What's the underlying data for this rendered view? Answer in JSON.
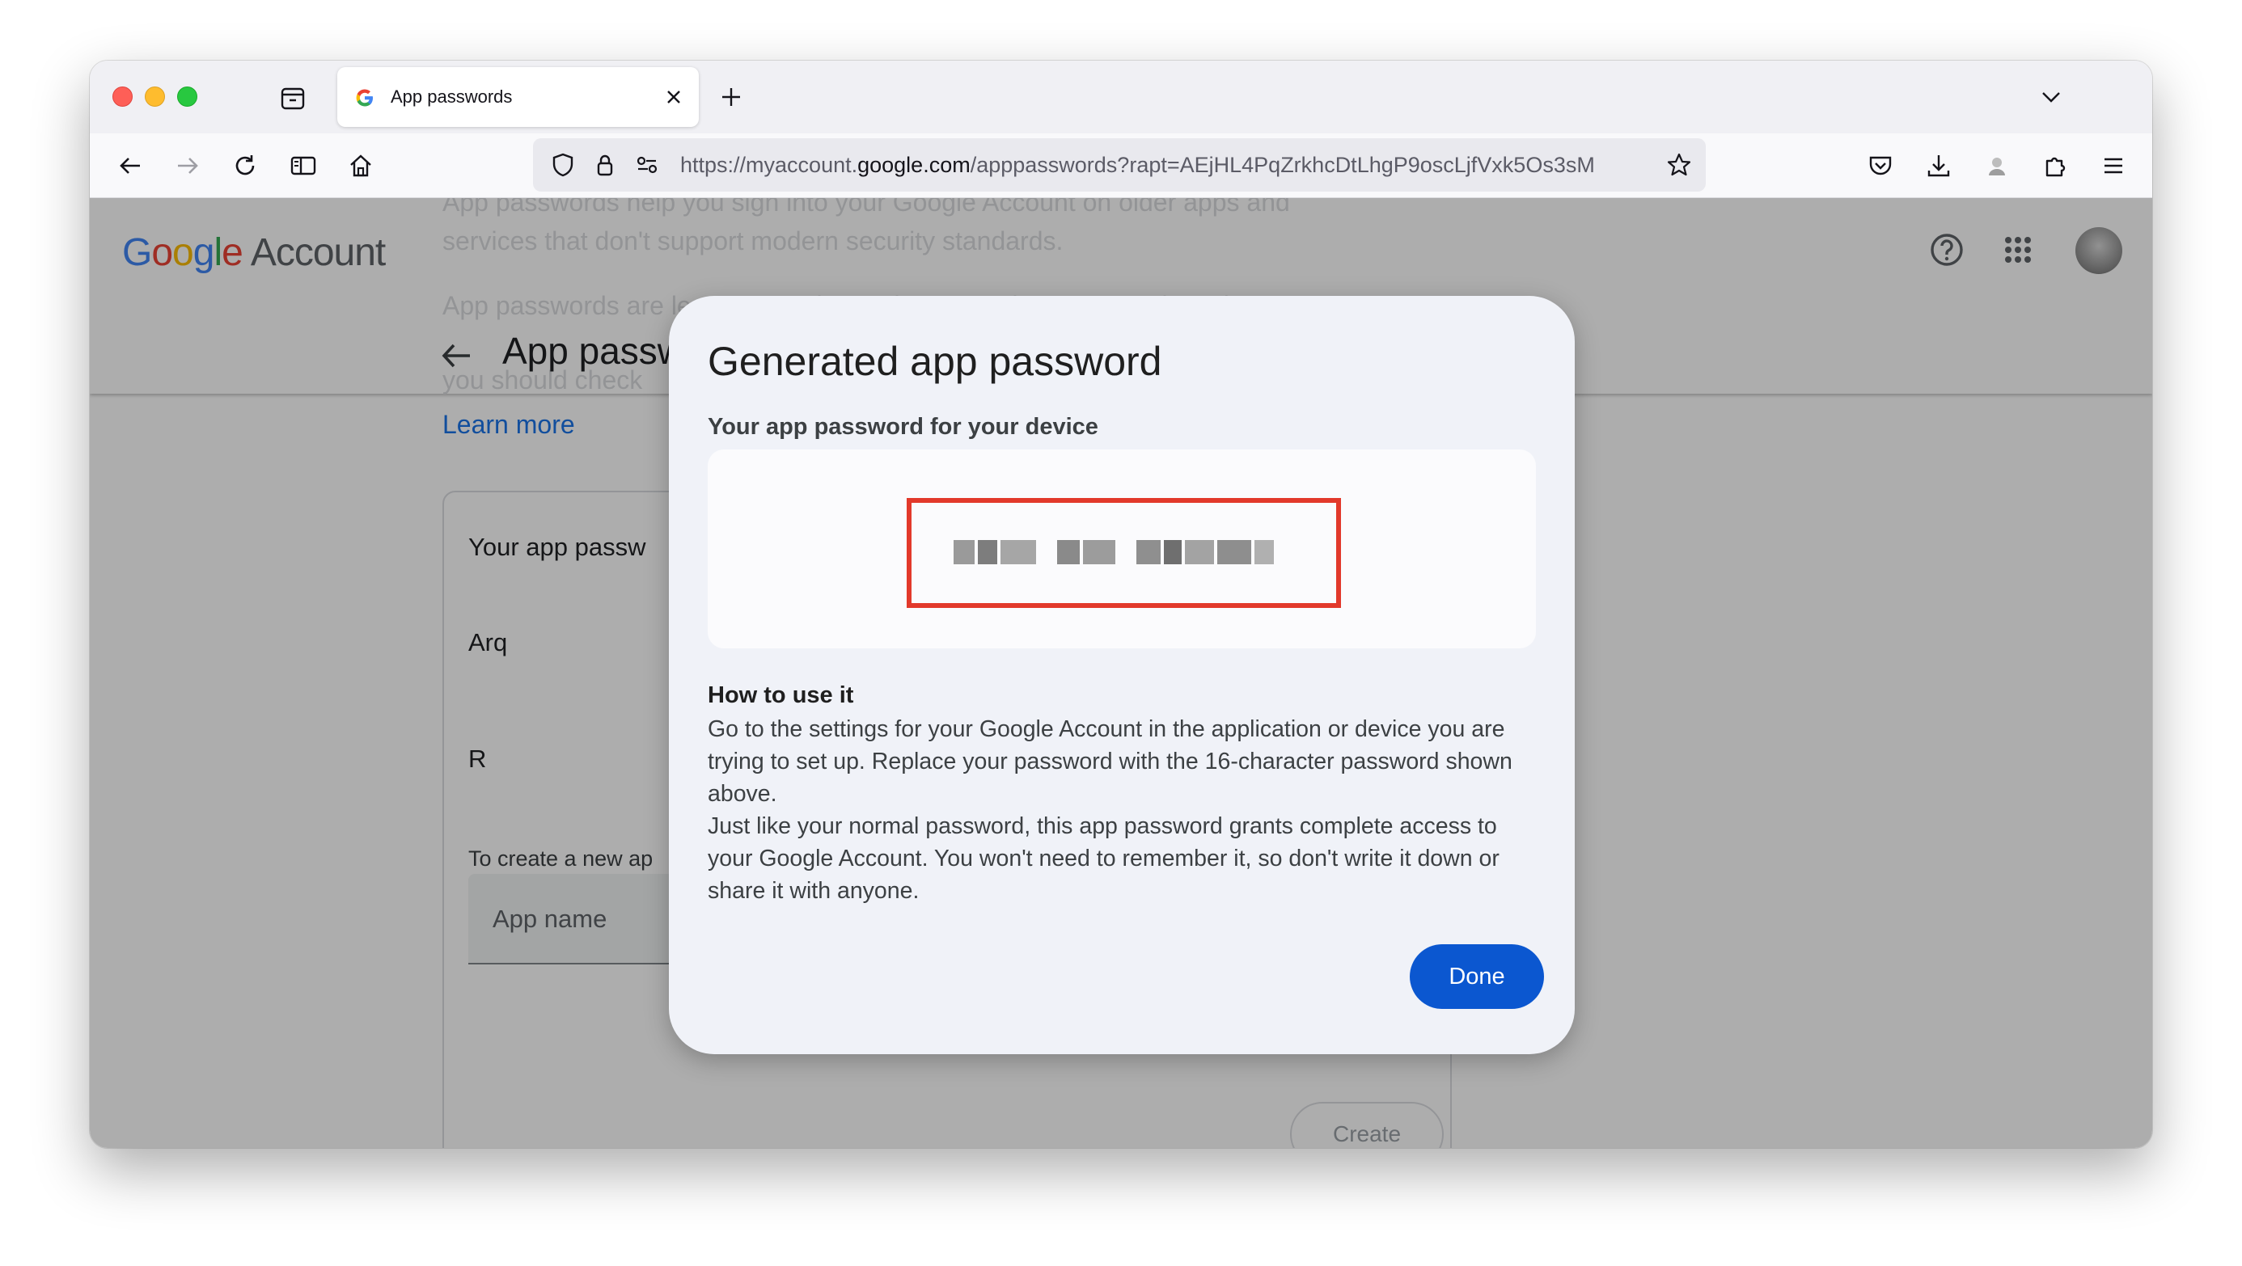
{
  "browser": {
    "tab_title": "App passwords",
    "url_prefix": "https://myaccount.",
    "url_host": "google.com",
    "url_path": "/apppasswords?rapt=AEjHL4PqZrkhcDtLhgP9oscLjfVxk5Os3sM"
  },
  "header": {
    "brand": [
      "G",
      "o",
      "o",
      "g",
      "l",
      "e"
    ],
    "brand_suffix": "Account"
  },
  "page": {
    "title": "App passw",
    "learn_more": "Learn more",
    "faded_line_1": "App passwords help you sign into your Google Account on older apps and",
    "faded_line_2": "services that don't support modern security standards.",
    "faded_line_3": "App passwords are less secure than using up-to-date apps and services",
    "faded_line_4": "you should check",
    "card_title": "Your app passw",
    "app_item_1": "Arq",
    "app_item_2": "R",
    "create_hint": "To create a new ap",
    "app_name_label": "App name",
    "create_button": "Create"
  },
  "dialog": {
    "title": "Generated app password",
    "subtitle": "Your app password for your device",
    "howto_heading": "How to use it",
    "howto_p1_l1": "Go to the settings for your Google Account in the application or device you are",
    "howto_p1_l2": "trying to set up. Replace your password with the 16-character password shown",
    "howto_p1_l3": "above.",
    "howto_p2_l1": "Just like your normal password, this app password grants complete access to",
    "howto_p2_l2": "your Google Account. You won't need to remember it, so don't write it down or",
    "howto_p2_l3": "share it with anyone.",
    "done_button": "Done"
  },
  "colors": {
    "highlight": "#e2392b",
    "primary_button": "#0b57d0",
    "link": "#1a73e8"
  }
}
